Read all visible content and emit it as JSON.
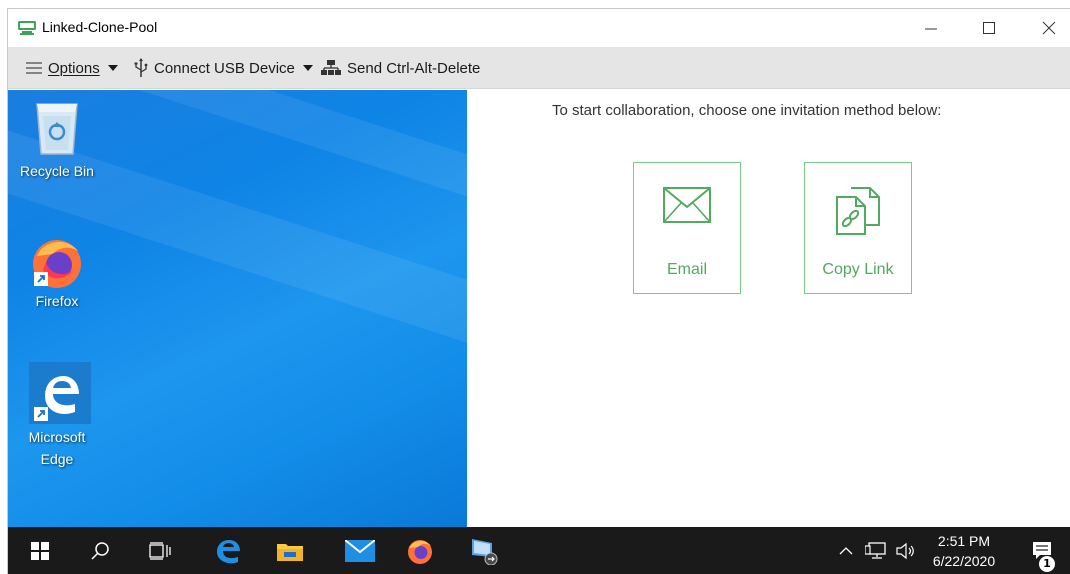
{
  "window": {
    "title": "Linked-Clone-Pool"
  },
  "toolbar": {
    "options_label": "Options",
    "usb_label": "Connect USB Device",
    "cad_label": "Send Ctrl-Alt-Delete"
  },
  "desktop": {
    "icons": [
      {
        "label": "Recycle Bin",
        "icon": "recycle-bin-icon"
      },
      {
        "label": "Firefox",
        "icon": "firefox-icon"
      },
      {
        "label": "Microsoft Edge",
        "icon": "edge-icon"
      }
    ]
  },
  "collaboration": {
    "message": "To start collaboration, choose one invitation method below:",
    "email_label": "Email",
    "copy_link_label": "Copy Link",
    "accent_color": "#52a960"
  },
  "taskbar": {
    "time": "2:51 PM",
    "date": "6/22/2020",
    "notification_count": "1"
  }
}
